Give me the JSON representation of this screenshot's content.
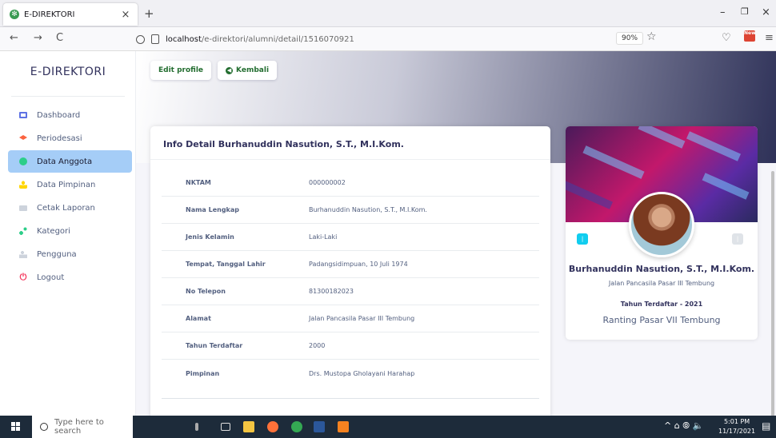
{
  "browser": {
    "tab_title": "E-DIREKTORI",
    "tab_close": "×",
    "new_tab": "+",
    "nav_back": "←",
    "nav_forward": "→",
    "nav_reload": "C",
    "url_domain": "localhost",
    "url_path": "/e-direktori/alumni/detail/1516070921",
    "zoom": "90%",
    "bookmark_icon": "☆",
    "pocket_icon": "♡",
    "menu_icon": "≡",
    "extension_badge": "New",
    "window_minimize": "–",
    "window_restore": "❐",
    "window_close": "×"
  },
  "sidebar": {
    "brand": "E-DIREKTORI",
    "items": [
      {
        "label": "Dashboard",
        "icon": "monitor-icon",
        "color": "#5e72e4"
      },
      {
        "label": "Periodesasi",
        "icon": "graduation-cap-icon",
        "color": "#fb6340"
      },
      {
        "label": "Data Anggota",
        "icon": "user-circle-icon",
        "color": "#2dce89"
      },
      {
        "label": "Data Pimpinan",
        "icon": "user-icon",
        "color": "#ffd600"
      },
      {
        "label": "Cetak Laporan",
        "icon": "print-icon",
        "color": "#cdd3dc"
      },
      {
        "label": "Kategori",
        "icon": "tags-icon",
        "color": "#2dce89"
      },
      {
        "label": "Pengguna",
        "icon": "users-icon",
        "color": "#cdd3dc"
      },
      {
        "label": "Logout",
        "icon": "power-icon",
        "color": "#f5365c"
      }
    ],
    "active_index": 2
  },
  "actions": {
    "edit_label": "Edit profile",
    "back_label": "Kembali"
  },
  "detail": {
    "title": "Info Detail Burhanuddin Nasution, S.T., M.I.Kom.",
    "rows": [
      {
        "key": "NKTAM",
        "value": "000000002"
      },
      {
        "key": "Nama Lengkap",
        "value": "Burhanuddin Nasution, S.T., M.I.Kom."
      },
      {
        "key": "Jenis Kelamin",
        "value": "Laki-Laki"
      },
      {
        "key": "Tempat, Tanggal Lahir",
        "value": "Padangsidimpuan, 10 Juli 1974"
      },
      {
        "key": "No Telepon",
        "value": "81300182023"
      },
      {
        "key": "Alamat",
        "value": "Jalan Pancasila Pasar III Tembung"
      },
      {
        "key": "Tahun Terdaftar",
        "value": "2000"
      },
      {
        "key": "Pimpinan",
        "value": "Drs. Mustopa Gholayani Harahap"
      }
    ]
  },
  "profile": {
    "name": "Burhanuddin Nasution, S.T., M.I.Kom.",
    "address": "Jalan Pancasila Pasar III Tembung",
    "year_label": "Tahun Terdaftar - 2021",
    "branch": "Ranting Pasar VII Tembung"
  },
  "taskbar": {
    "search_placeholder": "Type here to search",
    "time": "5:01 PM",
    "date": "11/17/2021",
    "tray_icons": "^ ⌂ ⦾ 🔈"
  }
}
